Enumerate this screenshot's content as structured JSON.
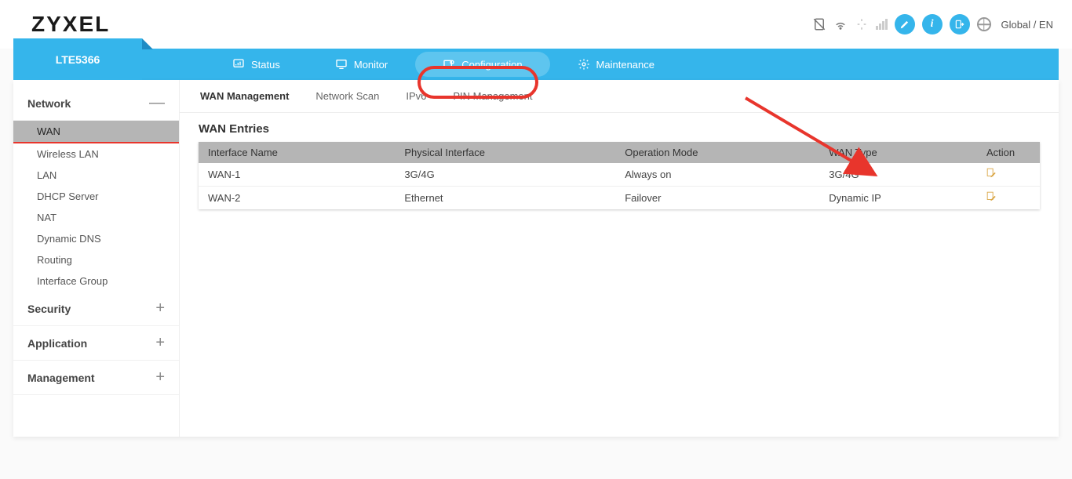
{
  "brand": "ZYXEL",
  "lang": "Global / EN",
  "device": "LTE5366",
  "topnav": {
    "status": "Status",
    "monitor": "Monitor",
    "configuration": "Configuration",
    "maintenance": "Maintenance"
  },
  "sidebar": {
    "groups": [
      {
        "name": "Network",
        "expanded": true,
        "items": [
          "WAN",
          "Wireless LAN",
          "LAN",
          "DHCP Server",
          "NAT",
          "Dynamic DNS",
          "Routing",
          "Interface Group"
        ],
        "active": "WAN"
      },
      {
        "name": "Security",
        "expanded": false
      },
      {
        "name": "Application",
        "expanded": false
      },
      {
        "name": "Management",
        "expanded": false
      }
    ]
  },
  "subtabs": {
    "items": [
      "WAN Management",
      "Network Scan",
      "IPv6",
      "PIN Management"
    ],
    "active": "WAN Management"
  },
  "table": {
    "title": "WAN Entries",
    "headers": [
      "Interface Name",
      "Physical Interface",
      "Operation Mode",
      "WAN Type",
      "Action"
    ],
    "rows": [
      {
        "iface": "WAN-1",
        "phy": "3G/4G",
        "mode": "Always on",
        "type": "3G/4G"
      },
      {
        "iface": "WAN-2",
        "phy": "Ethernet",
        "mode": "Failover",
        "type": "Dynamic IP"
      }
    ]
  }
}
